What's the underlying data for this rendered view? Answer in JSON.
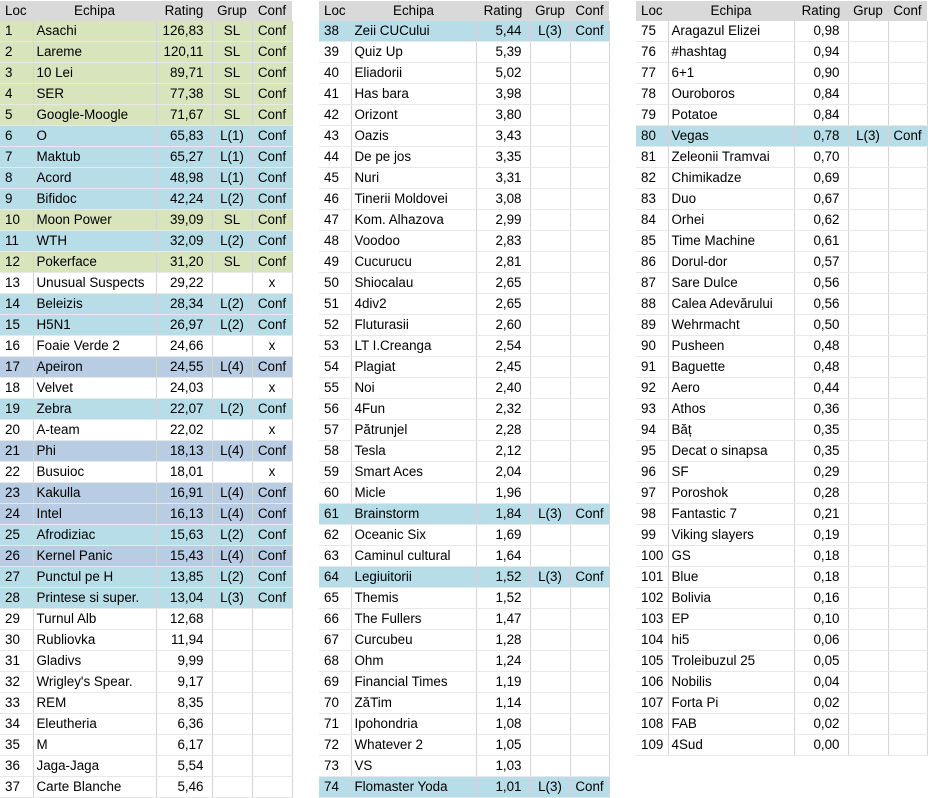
{
  "headers": [
    "Loc",
    "Echipa",
    "Rating",
    "Grup",
    "Conf"
  ],
  "colors": {
    "SL": "#d8e4bc",
    "L(1)": "#b7dee8",
    "L(2)": "#b7dee8",
    "L(3)": "#b7dee8",
    "L(4)": "#b8cce4",
    "header": "#d9d9d9"
  },
  "tables": [
    [
      [
        "1",
        "Asachi",
        "126,83",
        "SL",
        "Conf"
      ],
      [
        "2",
        "Lareme",
        "120,11",
        "SL",
        "Conf"
      ],
      [
        "3",
        "10 Lei",
        "89,71",
        "SL",
        "Conf"
      ],
      [
        "4",
        "SER",
        "77,38",
        "SL",
        "Conf"
      ],
      [
        "5",
        "Google-Moogle",
        "71,67",
        "SL",
        "Conf"
      ],
      [
        "6",
        "O",
        "65,83",
        "L(1)",
        "Conf"
      ],
      [
        "7",
        "Maktub",
        "65,27",
        "L(1)",
        "Conf"
      ],
      [
        "8",
        "Acord",
        "48,98",
        "L(1)",
        "Conf"
      ],
      [
        "9",
        "Bifidoc",
        "42,24",
        "L(2)",
        "Conf"
      ],
      [
        "10",
        "Moon Power",
        "39,09",
        "SL",
        "Conf"
      ],
      [
        "11",
        "WTH",
        "32,09",
        "L(2)",
        "Conf"
      ],
      [
        "12",
        "Pokerface",
        "31,20",
        "SL",
        "Conf"
      ],
      [
        "13",
        "Unusual Suspects",
        "29,22",
        "",
        "x"
      ],
      [
        "14",
        "Beleizis",
        "28,34",
        "L(2)",
        "Conf"
      ],
      [
        "15",
        "H5N1",
        "26,97",
        "L(2)",
        "Conf"
      ],
      [
        "16",
        "Foaie Verde 2",
        "24,66",
        "",
        "x"
      ],
      [
        "17",
        "Apeiron",
        "24,55",
        "L(4)",
        "Conf"
      ],
      [
        "18",
        "Velvet",
        "24,03",
        "",
        "x"
      ],
      [
        "19",
        "Zebra",
        "22,07",
        "L(2)",
        "Conf"
      ],
      [
        "20",
        "A-team",
        "22,02",
        "",
        "x"
      ],
      [
        "21",
        "Phi",
        "18,13",
        "L(4)",
        "Conf"
      ],
      [
        "22",
        "Busuioc",
        "18,01",
        "",
        "x"
      ],
      [
        "23",
        "Kakulla",
        "16,91",
        "L(4)",
        "Conf"
      ],
      [
        "24",
        "Intel",
        "16,13",
        "L(4)",
        "Conf"
      ],
      [
        "25",
        "Afrodiziac",
        "15,63",
        "L(2)",
        "Conf"
      ],
      [
        "26",
        "Kernel Panic",
        "15,43",
        "L(4)",
        "Conf"
      ],
      [
        "27",
        "Punctul pe H",
        "13,85",
        "L(2)",
        "Conf"
      ],
      [
        "28",
        "Printese si super.",
        "13,04",
        "L(3)",
        "Conf"
      ],
      [
        "29",
        "Turnul Alb",
        "12,68",
        "",
        ""
      ],
      [
        "30",
        "Rubliovka",
        "11,94",
        "",
        ""
      ],
      [
        "31",
        "Gladivs",
        "9,99",
        "",
        ""
      ],
      [
        "32",
        "Wrigley's Spear.",
        "9,17",
        "",
        ""
      ],
      [
        "33",
        "REM",
        "8,35",
        "",
        ""
      ],
      [
        "34",
        "Eleutheria",
        "6,36",
        "",
        ""
      ],
      [
        "35",
        "M",
        "6,17",
        "",
        ""
      ],
      [
        "36",
        "Jaga-Jaga",
        "5,54",
        "",
        ""
      ],
      [
        "37",
        "Carte Blanche",
        "5,46",
        "",
        ""
      ]
    ],
    [
      [
        "38",
        "Zeii CUCului",
        "5,44",
        "L(3)",
        "Conf"
      ],
      [
        "39",
        "Quiz Up",
        "5,39",
        "",
        ""
      ],
      [
        "40",
        "Eliadorii",
        "5,02",
        "",
        ""
      ],
      [
        "41",
        "Has bara",
        "3,98",
        "",
        ""
      ],
      [
        "42",
        "Orizont",
        "3,80",
        "",
        ""
      ],
      [
        "43",
        "Oazis",
        "3,43",
        "",
        ""
      ],
      [
        "44",
        "De pe jos",
        "3,35",
        "",
        ""
      ],
      [
        "45",
        "Nuri",
        "3,31",
        "",
        ""
      ],
      [
        "46",
        "Tinerii Moldovei",
        "3,08",
        "",
        ""
      ],
      [
        "47",
        "Kom. Alhazova",
        "2,99",
        "",
        ""
      ],
      [
        "48",
        "Voodoo",
        "2,83",
        "",
        ""
      ],
      [
        "49",
        "Cucurucu",
        "2,81",
        "",
        ""
      ],
      [
        "50",
        "Shiocalau",
        "2,65",
        "",
        ""
      ],
      [
        "51",
        "4div2",
        "2,65",
        "",
        ""
      ],
      [
        "52",
        "Fluturasii",
        "2,60",
        "",
        ""
      ],
      [
        "53",
        "LT I.Creanga",
        "2,54",
        "",
        ""
      ],
      [
        "54",
        "Plagiat",
        "2,45",
        "",
        ""
      ],
      [
        "55",
        "Noi",
        "2,40",
        "",
        ""
      ],
      [
        "56",
        "4Fun",
        "2,32",
        "",
        ""
      ],
      [
        "57",
        "Pătrunjel",
        "2,28",
        "",
        ""
      ],
      [
        "58",
        "Tesla",
        "2,12",
        "",
        ""
      ],
      [
        "59",
        "Smart Aces",
        "2,04",
        "",
        ""
      ],
      [
        "60",
        "Micle",
        "1,96",
        "",
        ""
      ],
      [
        "61",
        "Brainstorm",
        "1,84",
        "L(3)",
        "Conf"
      ],
      [
        "62",
        "Oceanic Six",
        "1,69",
        "",
        ""
      ],
      [
        "63",
        "Caminul cultural",
        "1,64",
        "",
        ""
      ],
      [
        "64",
        "Legiuitorii",
        "1,52",
        "L(3)",
        "Conf"
      ],
      [
        "65",
        "Themis",
        "1,52",
        "",
        ""
      ],
      [
        "66",
        "The Fullers",
        "1,47",
        "",
        ""
      ],
      [
        "67",
        "Curcubeu",
        "1,28",
        "",
        ""
      ],
      [
        "68",
        "Ohm",
        "1,24",
        "",
        ""
      ],
      [
        "69",
        "Financial Times",
        "1,19",
        "",
        ""
      ],
      [
        "70",
        "ZăTim",
        "1,14",
        "",
        ""
      ],
      [
        "71",
        "Ipohondria",
        "1,08",
        "",
        ""
      ],
      [
        "72",
        "Whatever 2",
        "1,05",
        "",
        ""
      ],
      [
        "73",
        "VS",
        "1,03",
        "",
        ""
      ],
      [
        "74",
        "Flomaster Yoda",
        "1,01",
        "L(3)",
        "Conf"
      ]
    ],
    [
      [
        "75",
        "Aragazul Elizei",
        "0,98",
        "",
        ""
      ],
      [
        "76",
        "#hashtag",
        "0,94",
        "",
        ""
      ],
      [
        "77",
        "6+1",
        "0,90",
        "",
        ""
      ],
      [
        "78",
        "Ouroboros",
        "0,84",
        "",
        ""
      ],
      [
        "79",
        "Potatoe",
        "0,84",
        "",
        ""
      ],
      [
        "80",
        "Vegas",
        "0,78",
        "L(3)",
        "Conf"
      ],
      [
        "81",
        "Zeleonii Tramvai",
        "0,70",
        "",
        ""
      ],
      [
        "82",
        "Chimikadze",
        "0,69",
        "",
        ""
      ],
      [
        "83",
        "Duo",
        "0,67",
        "",
        ""
      ],
      [
        "84",
        "Orhei",
        "0,62",
        "",
        ""
      ],
      [
        "85",
        "Time Machine",
        "0,61",
        "",
        ""
      ],
      [
        "86",
        "Dorul-dor",
        "0,57",
        "",
        ""
      ],
      [
        "87",
        "Sare Dulce",
        "0,56",
        "",
        ""
      ],
      [
        "88",
        "Calea Adevărului",
        "0,56",
        "",
        ""
      ],
      [
        "89",
        "Wehrmacht",
        "0,50",
        "",
        ""
      ],
      [
        "90",
        "Pusheen",
        "0,48",
        "",
        ""
      ],
      [
        "91",
        "Baguette",
        "0,48",
        "",
        ""
      ],
      [
        "92",
        "Aero",
        "0,44",
        "",
        ""
      ],
      [
        "93",
        "Athos",
        "0,36",
        "",
        ""
      ],
      [
        "94",
        "Băț",
        "0,35",
        "",
        ""
      ],
      [
        "95",
        "Decat o sinapsa",
        "0,35",
        "",
        ""
      ],
      [
        "96",
        "SF",
        "0,29",
        "",
        ""
      ],
      [
        "97",
        "Poroshok",
        "0,28",
        "",
        ""
      ],
      [
        "98",
        "Fantastic 7",
        "0,21",
        "",
        ""
      ],
      [
        "99",
        "Viking slayers",
        "0,19",
        "",
        ""
      ],
      [
        "100",
        "GS",
        "0,18",
        "",
        ""
      ],
      [
        "101",
        "Blue",
        "0,18",
        "",
        ""
      ],
      [
        "102",
        "Bolivia",
        "0,16",
        "",
        ""
      ],
      [
        "103",
        "EP",
        "0,10",
        "",
        ""
      ],
      [
        "104",
        "hi5",
        "0,06",
        "",
        ""
      ],
      [
        "105",
        "Troleibuzul 25",
        "0,05",
        "",
        ""
      ],
      [
        "106",
        "Nobilis",
        "0,04",
        "",
        ""
      ],
      [
        "107",
        "Forta Pi",
        "0,02",
        "",
        ""
      ],
      [
        "108",
        "FAB",
        "0,02",
        "",
        ""
      ],
      [
        "109",
        "4Sud",
        "0,00",
        "",
        ""
      ]
    ]
  ]
}
